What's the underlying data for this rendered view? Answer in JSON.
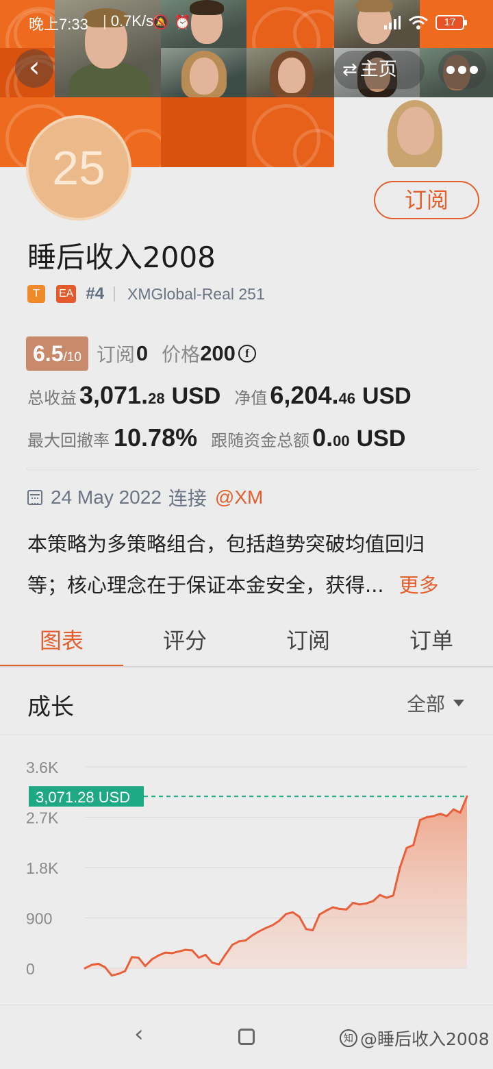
{
  "status_bar": {
    "time": "晚上7:33",
    "network_speed": "0.7K/s",
    "battery": "17"
  },
  "header": {
    "home_label": "主页",
    "avatar_text": "25",
    "subscribe_label": "订阅"
  },
  "profile": {
    "name": "睡后收入2008",
    "badge_t": "T",
    "badge_ea": "EA",
    "rank": "#4",
    "server": "XMGlobal-Real 251",
    "rating_score": "6.5",
    "rating_max": "/10",
    "subscribers_label": "订阅",
    "subscribers_value": "0",
    "price_label": "价格",
    "price_value": "200",
    "coin_symbol": "f"
  },
  "stats": {
    "total_profit_label": "总收益",
    "total_profit_int": "3,071.",
    "total_profit_dec": "28",
    "total_profit_unit": "USD",
    "equity_label": "净值",
    "equity_int": "6,204.",
    "equity_dec": "46",
    "equity_unit": "USD",
    "max_drawdown_label": "最大回撤率",
    "max_drawdown_value": "10.78%",
    "follow_funds_label": "跟随资金总额",
    "follow_funds_int": "0.",
    "follow_funds_dec": "00",
    "follow_funds_unit": "USD"
  },
  "meta": {
    "start_date": "24 May 2022",
    "connect_label": "连接",
    "broker": "@XM"
  },
  "description": {
    "line1": "本策略为多策略组合，包括趋势突破均值回归",
    "line2": "等；核心理念在于保证本金安全，获得...",
    "more_label": "更多"
  },
  "tabs": [
    {
      "label": "图表",
      "active": true
    },
    {
      "label": "评分",
      "active": false
    },
    {
      "label": "订阅",
      "active": false
    },
    {
      "label": "订单",
      "active": false
    }
  ],
  "chart_section": {
    "title": "成长",
    "range_label": "全部"
  },
  "nav": {
    "watermark": "@睡后收入2008",
    "watermark_logo": "知"
  },
  "colors": {
    "accent": "#e35f2e",
    "line": "#e8603a",
    "marker": "#1fa884"
  },
  "chart_data": {
    "type": "area",
    "title": "",
    "xlabel": "",
    "ylabel": "",
    "ylim": [
      0,
      3600
    ],
    "y_ticks": [
      {
        "value": 3600,
        "label": "3.6K"
      },
      {
        "value": 2700,
        "label": "2.7K"
      },
      {
        "value": 1800,
        "label": "1.8K"
      },
      {
        "value": 900,
        "label": "900"
      },
      {
        "value": 0,
        "label": "0"
      }
    ],
    "current_value": 3071.28,
    "current_label": "3,071.28 USD",
    "grid": true,
    "series": [
      {
        "values": [
          0,
          60,
          80,
          20,
          -130,
          -100,
          -50,
          200,
          190,
          40,
          160,
          230,
          280,
          270,
          300,
          330,
          320,
          190,
          240,
          100,
          70,
          250,
          420,
          480,
          500,
          590,
          660,
          720,
          770,
          850,
          970,
          1000,
          920,
          700,
          680,
          960,
          1030,
          1090,
          1060,
          1050,
          1170,
          1140,
          1160,
          1200,
          1310,
          1260,
          1300,
          1800,
          2150,
          2200,
          2650,
          2700,
          2720,
          2760,
          2720,
          2840,
          2780,
          3071
        ]
      }
    ]
  }
}
